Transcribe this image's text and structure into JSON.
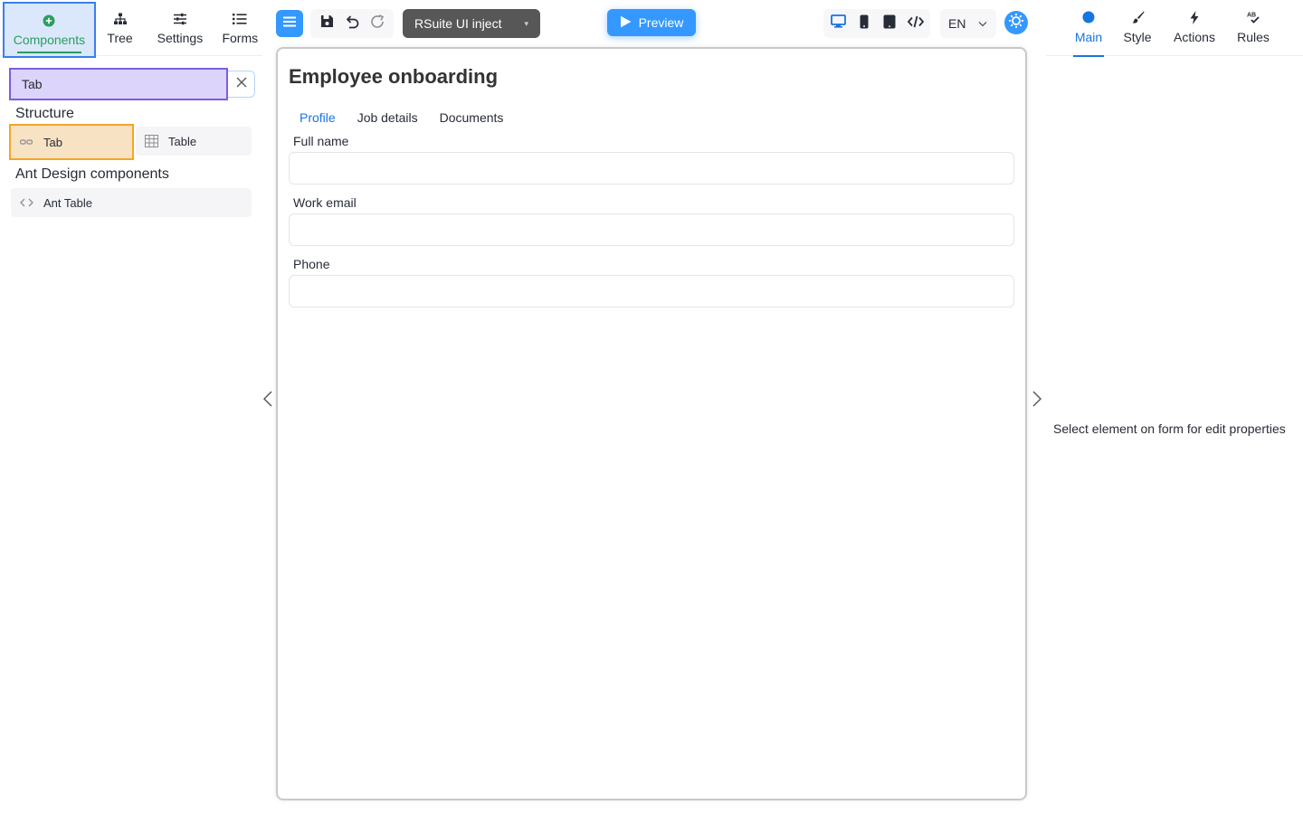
{
  "left_panel": {
    "tabs": [
      {
        "label": "Components",
        "icon": "plus-circle-icon"
      },
      {
        "label": "Tree",
        "icon": "sitemap-icon"
      },
      {
        "label": "Settings",
        "icon": "sliders-icon"
      },
      {
        "label": "Forms",
        "icon": "list-icon"
      }
    ],
    "search": {
      "value": "Tab",
      "placeholder": ""
    },
    "groups": [
      {
        "title": "Structure",
        "items": [
          {
            "label": "Tab",
            "icon": "tab-icon"
          },
          {
            "label": "Table",
            "icon": "table-icon"
          }
        ]
      },
      {
        "title": "Ant Design components",
        "items": [
          {
            "label": "Ant Table",
            "icon": "code-icon"
          }
        ]
      }
    ]
  },
  "toolbar": {
    "view_select": "RSuite UI inject",
    "preview_label": "Preview",
    "language": "EN"
  },
  "form": {
    "title": "Employee onboarding",
    "tabs": [
      {
        "label": "Profile",
        "active": true
      },
      {
        "label": "Job details",
        "active": false
      },
      {
        "label": "Documents",
        "active": false
      }
    ],
    "fields": [
      {
        "label": "Full name",
        "value": ""
      },
      {
        "label": "Work email",
        "value": ""
      },
      {
        "label": "Phone",
        "value": ""
      }
    ]
  },
  "right_panel": {
    "tabs": [
      {
        "label": "Main",
        "icon": "circle-icon"
      },
      {
        "label": "Style",
        "icon": "brush-icon"
      },
      {
        "label": "Actions",
        "icon": "lightning-icon"
      },
      {
        "label": "Rules",
        "icon": "spellcheck-icon"
      }
    ],
    "empty_message": "Select element on form for edit properties"
  },
  "colors": {
    "accent": "#3498ff",
    "active_link": "#1675e0",
    "components_tab": "#2a9d5f",
    "search_highlight": "#7c5ce0",
    "item_highlight": "#f5a623"
  }
}
